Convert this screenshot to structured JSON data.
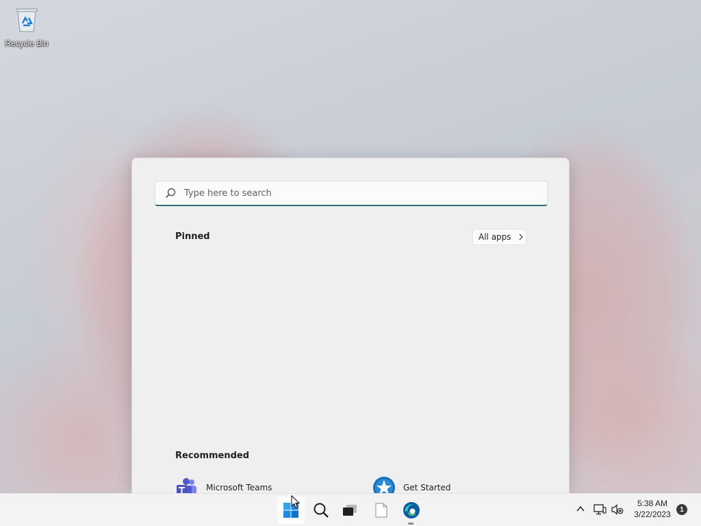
{
  "desktop": {
    "icons": [
      {
        "label": "Recycle Bin",
        "icon": "recycle-bin-icon"
      }
    ]
  },
  "start_menu": {
    "search": {
      "placeholder": "Type here to search",
      "value": ""
    },
    "pinned": {
      "title": "Pinned",
      "all_apps_label": "All apps",
      "items": []
    },
    "recommended": {
      "title": "Recommended",
      "items": [
        {
          "label": "Microsoft Teams",
          "icon": "teams-icon"
        },
        {
          "label": "Get Started",
          "icon": "get-started-icon"
        }
      ]
    }
  },
  "taskbar": {
    "buttons": [
      {
        "name": "Start",
        "icon": "windows-start-icon"
      },
      {
        "name": "Search",
        "icon": "search-icon"
      },
      {
        "name": "Task View",
        "icon": "task-view-icon"
      },
      {
        "name": "File",
        "icon": "file-icon"
      },
      {
        "name": "Microsoft Edge",
        "icon": "edge-icon"
      }
    ],
    "tray": {
      "time": "5:38 AM",
      "date": "3/22/2023",
      "notification_count": "1"
    }
  },
  "colors": {
    "accent": "#0078d4",
    "search_underline": "#2f6d72",
    "start_menu_bg": "#efefef",
    "taskbar_bg": "#f3f3f3"
  }
}
